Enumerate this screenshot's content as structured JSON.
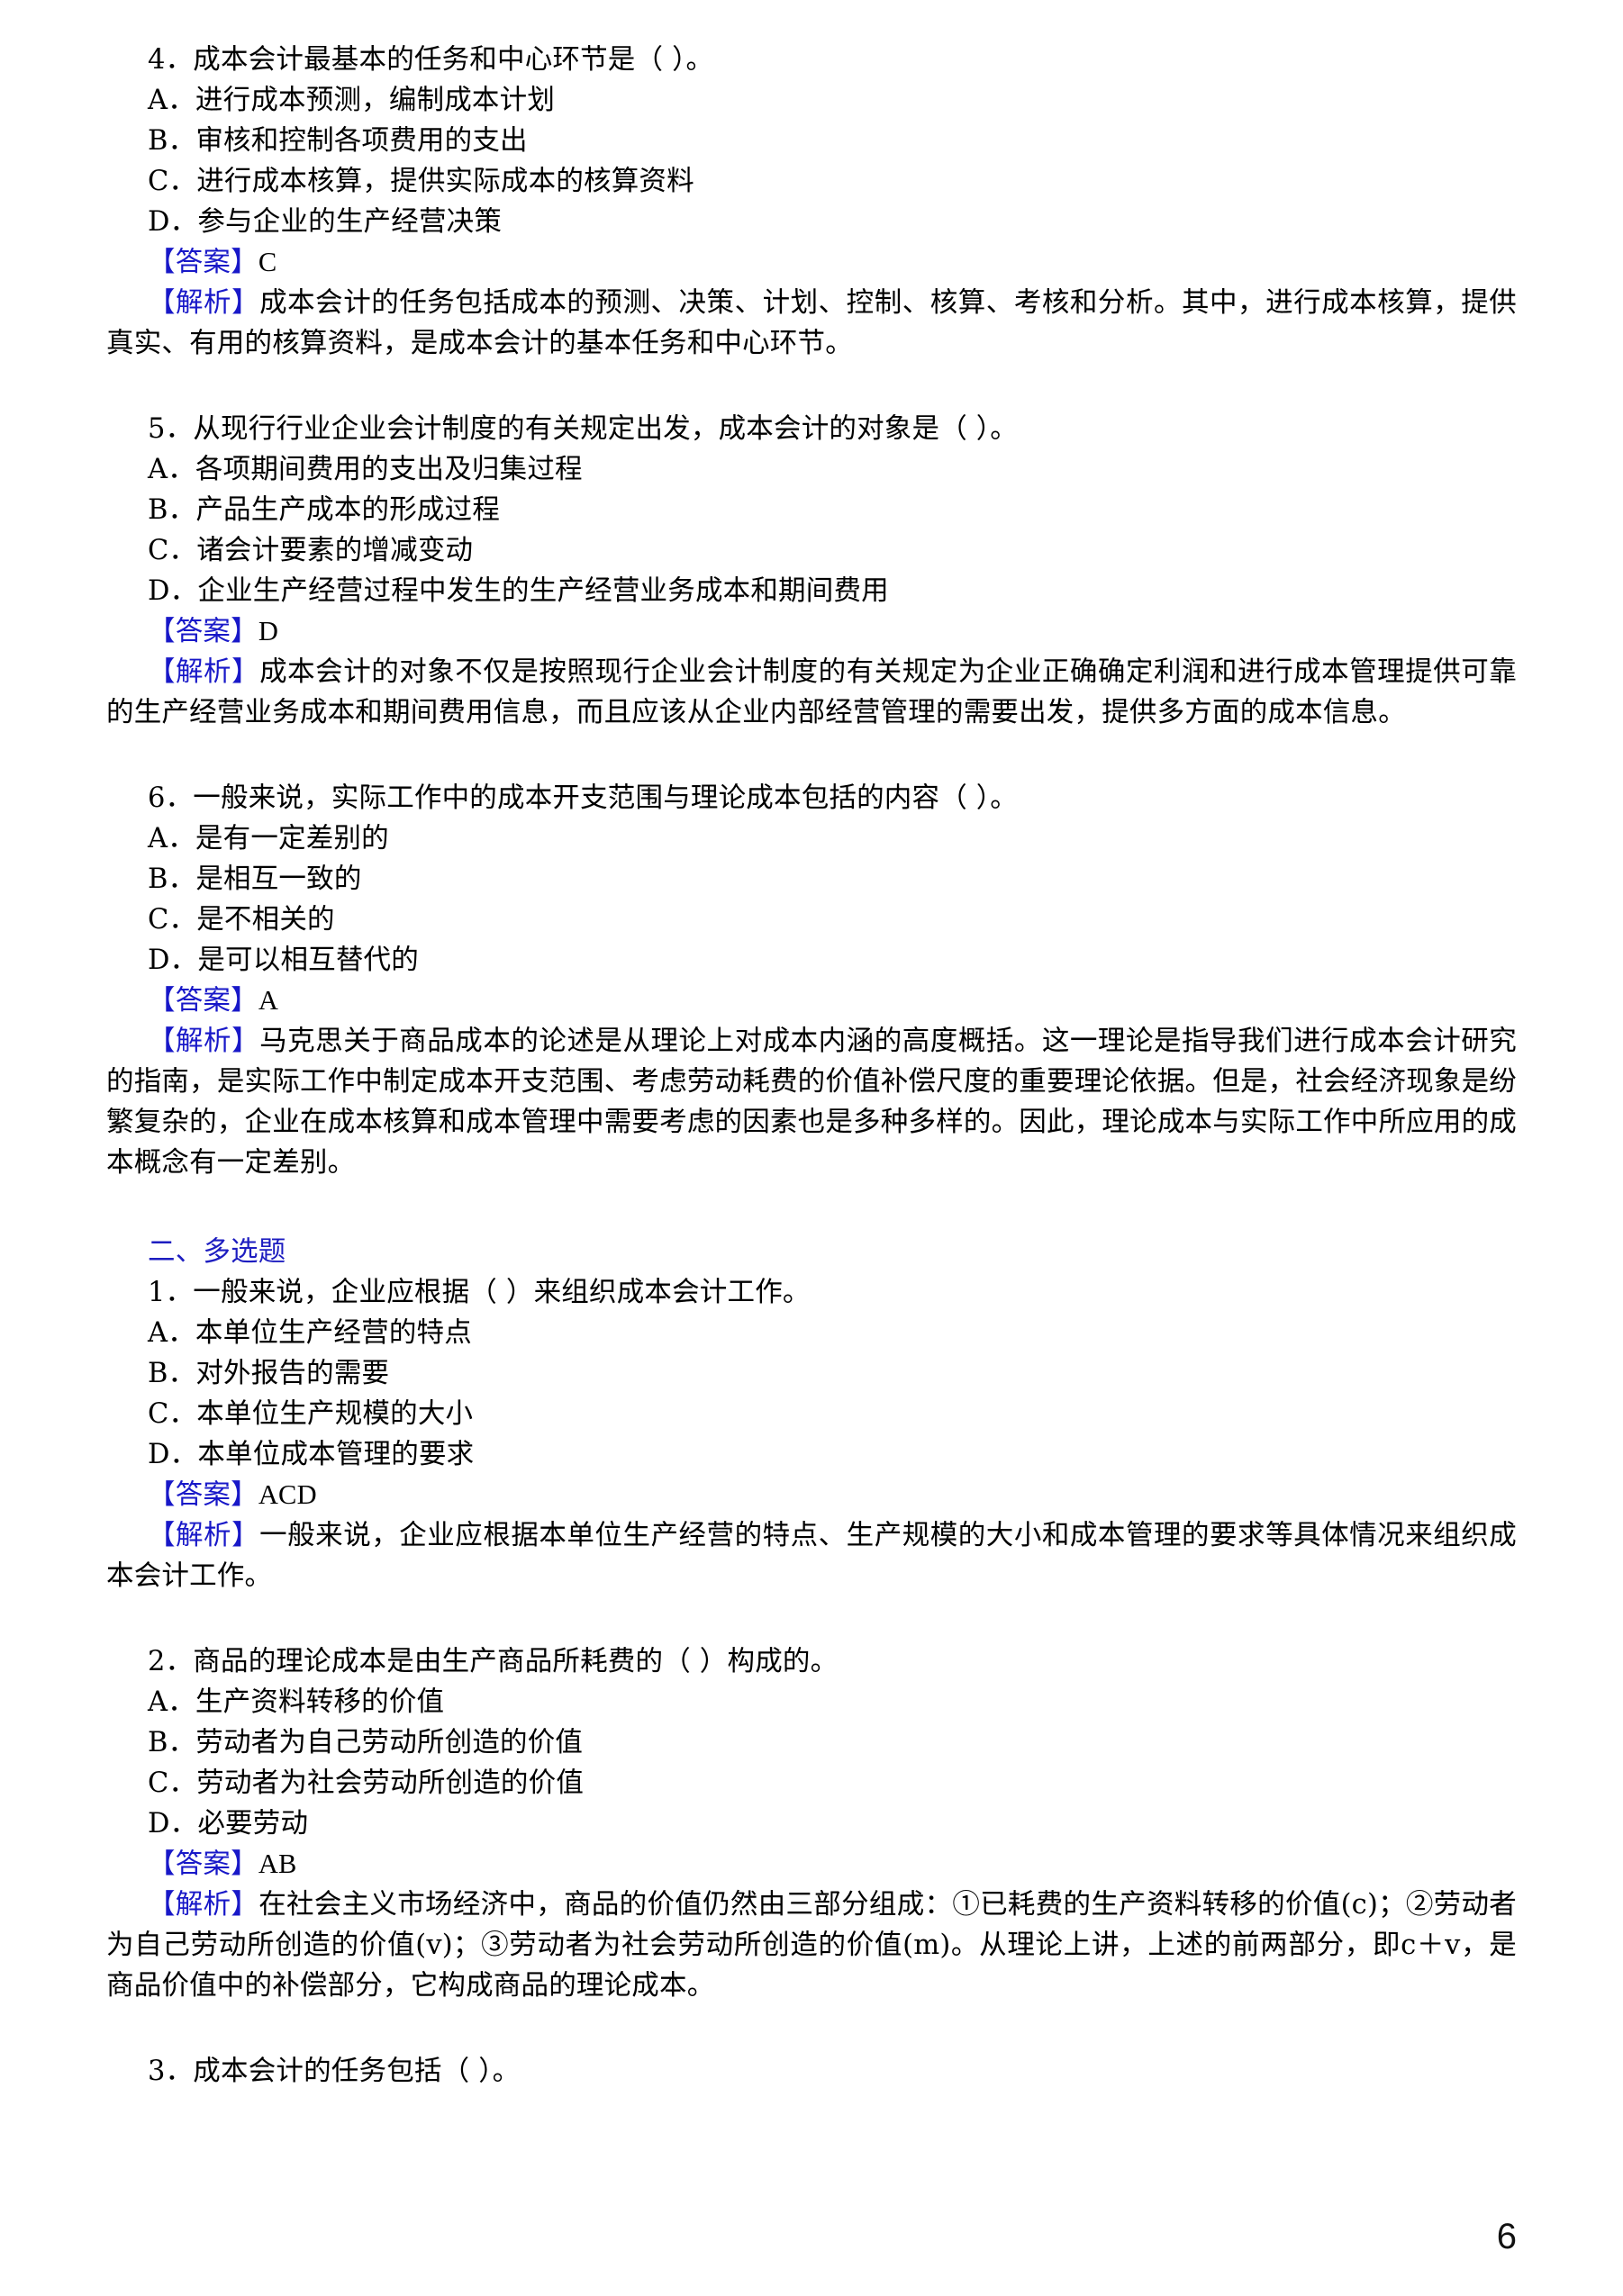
{
  "page": {
    "number": "6",
    "accent_blue": "#1818c8",
    "section_blue": "#1d1dc0",
    "background": "#ffffff",
    "text_color": "#000000"
  },
  "labels": {
    "answer": "【答案】",
    "explanation": "【解析】"
  },
  "single_choice": {
    "questions": [
      {
        "stem": "4．成本会计最基本的任务和中心环节是（      ）。",
        "options": [
          "A．进行成本预测，编制成本计划",
          "B．审核和控制各项费用的支出",
          "C．进行成本核算，提供实际成本的核算资料",
          "D．参与企业的生产经营决策"
        ],
        "answer": "C",
        "explanation": "成本会计的任务包括成本的预测、决策、计划、控制、核算、考核和分析。其中，进行成本核算，提供真实、有用的核算资料，是成本会计的基本任务和中心环节。"
      },
      {
        "stem": "5．从现行行业企业会计制度的有关规定出发，成本会计的对象是（      ）。",
        "options": [
          "A．各项期间费用的支出及归集过程",
          "B．产品生产成本的形成过程",
          "C．诸会计要素的增减变动",
          "D．企业生产经营过程中发生的生产经营业务成本和期间费用"
        ],
        "answer": "D",
        "explanation": "成本会计的对象不仅是按照现行企业会计制度的有关规定为企业正确确定利润和进行成本管理提供可靠的生产经营业务成本和期间费用信息，而且应该从企业内部经营管理的需要出发，提供多方面的成本信息。"
      },
      {
        "stem": "6．一般来说，实际工作中的成本开支范围与理论成本包括的内容（      ）。",
        "options": [
          "A．是有一定差别的",
          "B．是相互一致的",
          "C．是不相关的",
          "D．是可以相互替代的"
        ],
        "answer": "A",
        "explanation": "马克思关于商品成本的论述是从理论上对成本内涵的高度概括。这一理论是指导我们进行成本会计研究的指南，是实际工作中制定成本开支范围、考虑劳动耗费的价值补偿尺度的重要理论依据。但是，社会经济现象是纷繁复杂的，企业在成本核算和成本管理中需要考虑的因素也是多种多样的。因此，理论成本与实际工作中所应用的成本概念有一定差别。"
      }
    ]
  },
  "multi_choice": {
    "heading": "二、多选题",
    "questions": [
      {
        "stem": "1．一般来说，企业应根据（      ）来组织成本会计工作。",
        "options": [
          "A．本单位生产经营的特点",
          "B．对外报告的需要",
          "C．本单位生产规模的大小",
          "D．本单位成本管理的要求"
        ],
        "answer": "ACD",
        "explanation": "一般来说，企业应根据本单位生产经营的特点、生产规模的大小和成本管理的要求等具体情况来组织成本会计工作。"
      },
      {
        "stem": "2．商品的理论成本是由生产商品所耗费的（      ）构成的。",
        "options": [
          "A．生产资料转移的价值",
          "B．劳动者为自己劳动所创造的价值",
          "C．劳动者为社会劳动所创造的价值",
          "D．必要劳动"
        ],
        "answer": "AB",
        "explanation": "在社会主义市场经济中，商品的价值仍然由三部分组成：①已耗费的生产资料转移的价值(c)；②劳动者为自己劳动所创造的价值(v)；③劳动者为社会劳动所创造的价值(m)。从理论上讲，上述的前两部分，即c＋v，是商品价值中的补偿部分，它构成商品的理论成本。"
      },
      {
        "stem": "3．成本会计的任务包括（      ）。",
        "options": [],
        "answer": "",
        "explanation": ""
      }
    ]
  }
}
